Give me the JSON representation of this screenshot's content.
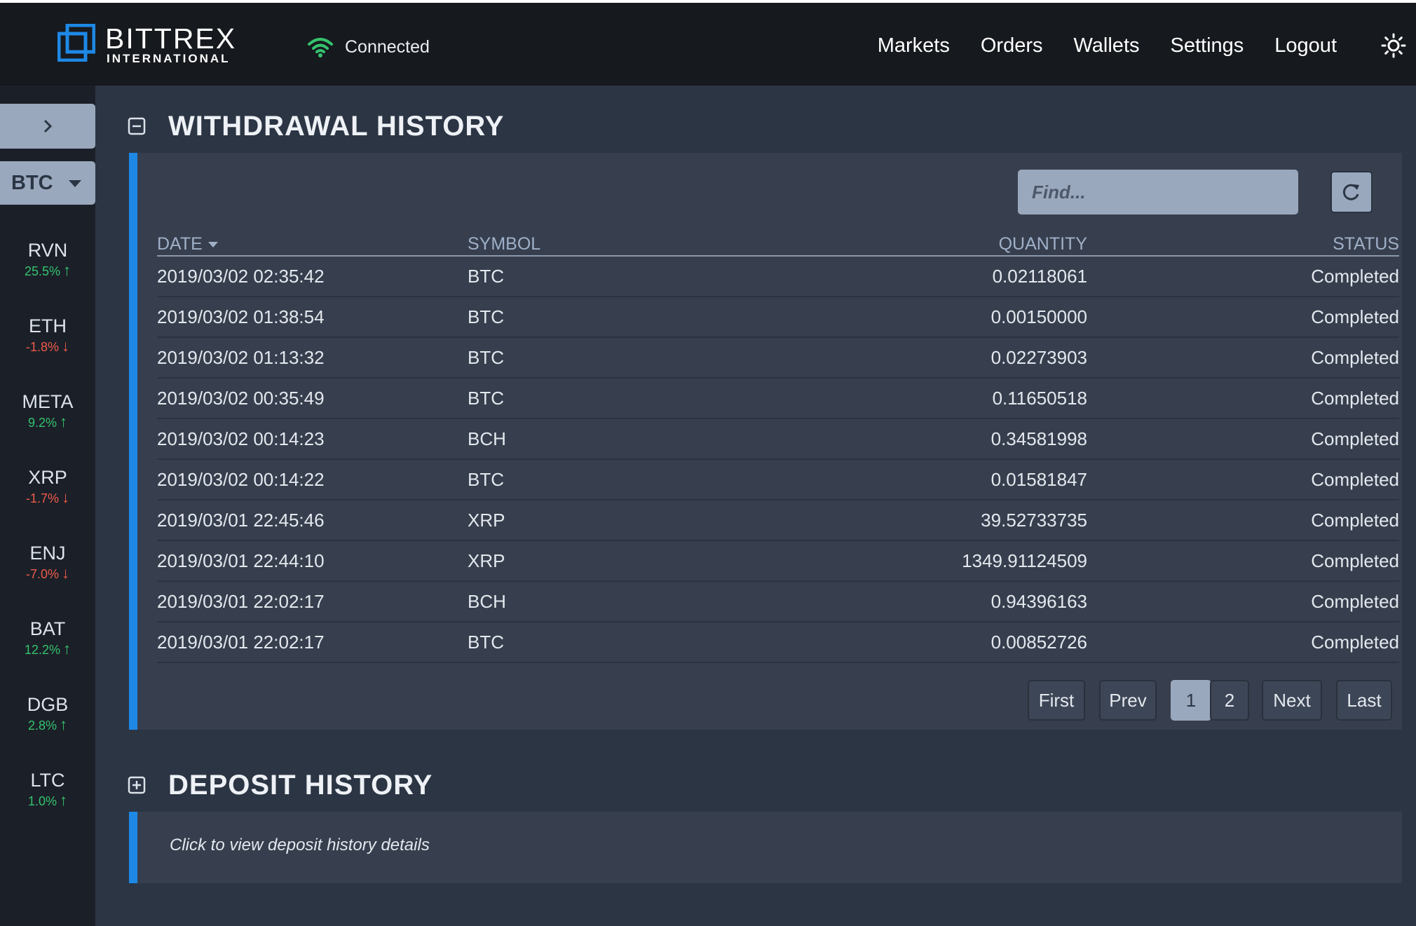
{
  "header": {
    "brand_name": "BITTREX",
    "brand_sub": "INTERNATIONAL",
    "connection_status": "Connected",
    "nav": [
      "Markets",
      "Orders",
      "Wallets",
      "Settings",
      "Logout"
    ]
  },
  "sidebar": {
    "collapse_icon": "chevron-right-icon",
    "base_currency": "BTC",
    "tickers": [
      {
        "symbol": "RVN",
        "change": "25.5%",
        "direction": "up"
      },
      {
        "symbol": "ETH",
        "change": "-1.8%",
        "direction": "down"
      },
      {
        "symbol": "META",
        "change": "9.2%",
        "direction": "up"
      },
      {
        "symbol": "XRP",
        "change": "-1.7%",
        "direction": "down"
      },
      {
        "symbol": "ENJ",
        "change": "-7.0%",
        "direction": "down"
      },
      {
        "symbol": "BAT",
        "change": "12.2%",
        "direction": "up"
      },
      {
        "symbol": "DGB",
        "change": "2.8%",
        "direction": "up"
      },
      {
        "symbol": "LTC",
        "change": "1.0%",
        "direction": "up"
      }
    ]
  },
  "withdrawal": {
    "title": "WITHDRAWAL HISTORY",
    "search_placeholder": "Find...",
    "columns": [
      "DATE",
      "SYMBOL",
      "QUANTITY",
      "STATUS"
    ],
    "rows": [
      {
        "date": "2019/03/02 02:35:42",
        "symbol": "BTC",
        "quantity": "0.02118061",
        "status": "Completed"
      },
      {
        "date": "2019/03/02 01:38:54",
        "symbol": "BTC",
        "quantity": "0.00150000",
        "status": "Completed"
      },
      {
        "date": "2019/03/02 01:13:32",
        "symbol": "BTC",
        "quantity": "0.02273903",
        "status": "Completed"
      },
      {
        "date": "2019/03/02 00:35:49",
        "symbol": "BTC",
        "quantity": "0.11650518",
        "status": "Completed"
      },
      {
        "date": "2019/03/02 00:14:23",
        "symbol": "BCH",
        "quantity": "0.34581998",
        "status": "Completed"
      },
      {
        "date": "2019/03/02 00:14:22",
        "symbol": "BTC",
        "quantity": "0.01581847",
        "status": "Completed"
      },
      {
        "date": "2019/03/01 22:45:46",
        "symbol": "XRP",
        "quantity": "39.52733735",
        "status": "Completed"
      },
      {
        "date": "2019/03/01 22:44:10",
        "symbol": "XRP",
        "quantity": "1349.91124509",
        "status": "Completed"
      },
      {
        "date": "2019/03/01 22:02:17",
        "symbol": "BCH",
        "quantity": "0.94396163",
        "status": "Completed"
      },
      {
        "date": "2019/03/01 22:02:17",
        "symbol": "BTC",
        "quantity": "0.00852726",
        "status": "Completed"
      }
    ],
    "pagination": {
      "first": "First",
      "prev": "Prev",
      "pages": [
        "1",
        "2"
      ],
      "current": "1",
      "next": "Next",
      "last": "Last"
    }
  },
  "deposit": {
    "title": "DEPOSIT HISTORY",
    "note": "Click to view deposit history details"
  },
  "colors": {
    "accent": "#1e88e5",
    "positive": "#35c26e",
    "negative": "#ef5a4a",
    "control": "#9aa8bd"
  }
}
